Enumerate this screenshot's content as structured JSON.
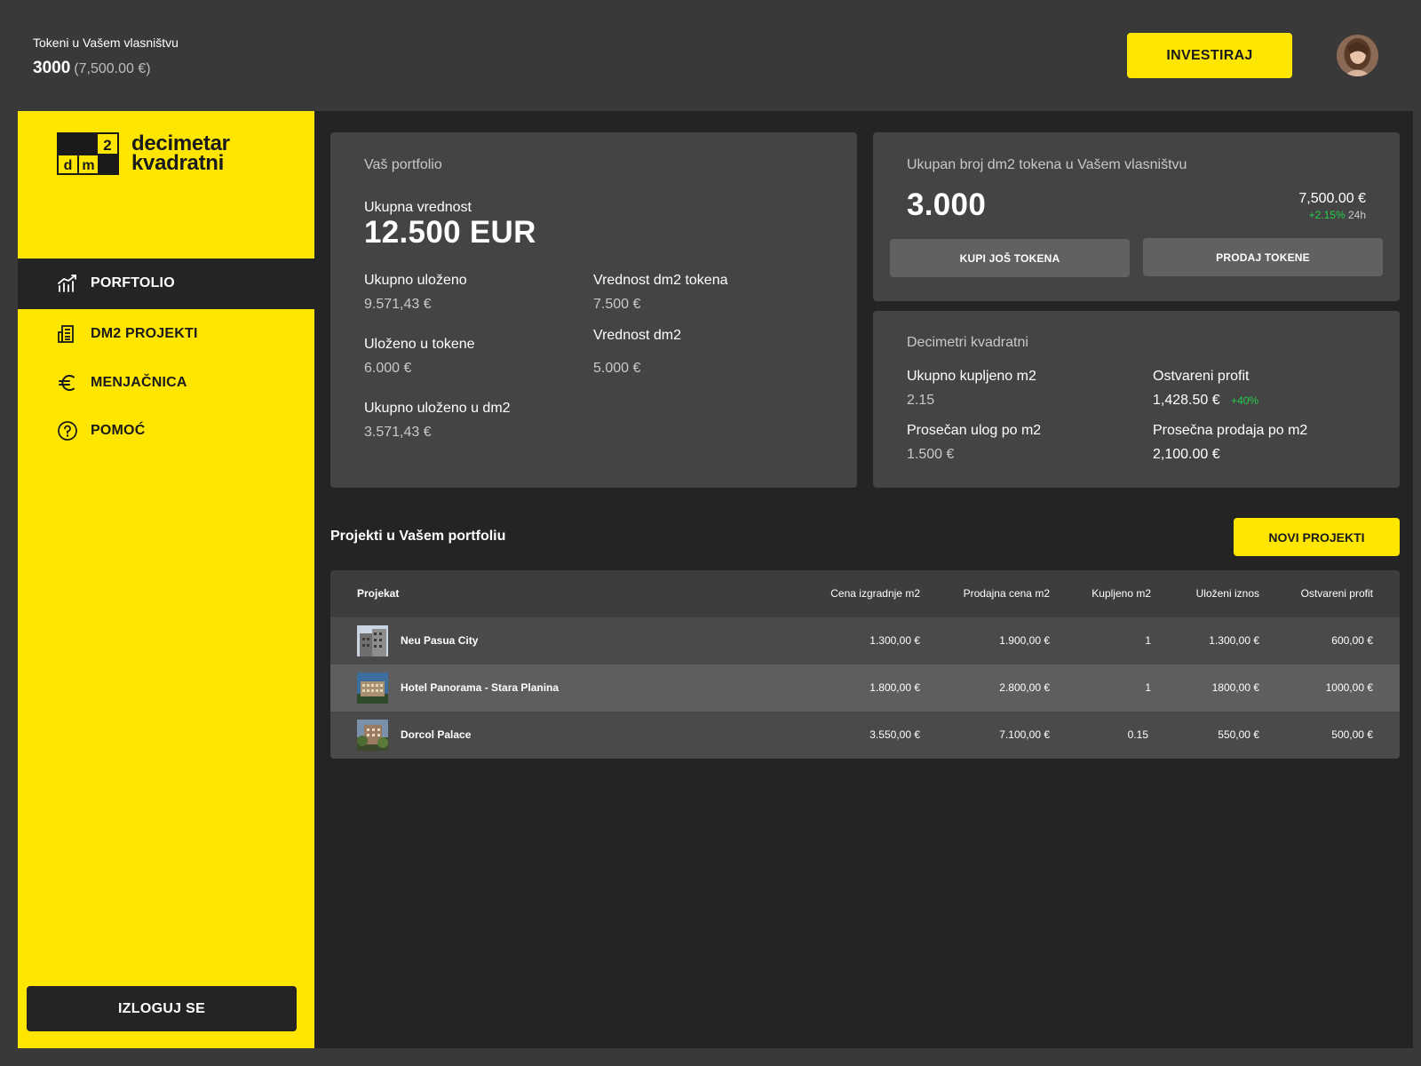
{
  "header": {
    "tokens_label": "Tokeni u Vašem vlasništvu",
    "tokens_count": "3000",
    "tokens_eur": "(7,500.00 €)",
    "invest_label": "INVESTIRAJ"
  },
  "sidebar": {
    "logo_text_line1": "decimetar",
    "logo_text_line2": "kvadratni",
    "logo_mark": {
      "d": "d",
      "m": "m",
      "two": "2"
    },
    "items": [
      {
        "label": "PORFTOLIO",
        "icon": "chart-icon",
        "active": true
      },
      {
        "label": "DM2 PROJEKTI",
        "icon": "building-icon",
        "active": false
      },
      {
        "label": "MENJAČNICA",
        "icon": "euro-icon",
        "active": false
      },
      {
        "label": "POMOĆ",
        "icon": "help-icon",
        "active": false
      }
    ],
    "logout_label": "IZLOGUJ SE"
  },
  "portfolio": {
    "title": "Vaš portfolio",
    "total_label": "Ukupna vrednost",
    "total_value": "12.500 EUR",
    "invested_label": "Ukupno uloženo",
    "invested_value": "9.571,43 €",
    "token_value_label": "Vrednost dm2 tokena",
    "token_value": "7.500 €",
    "in_tokens_label": "Uloženo u tokene",
    "in_tokens_value": "6.000 €",
    "dm2_value_label": "Vrednost dm2",
    "dm2_value": "5.000 €",
    "in_dm2_label": "Ukupno uloženo u dm2",
    "in_dm2_value": "3.571,43 €"
  },
  "tokens_card": {
    "title": "Ukupan broj dm2 tokena u Vašem vlasništvu",
    "count": "3.000",
    "eur_value": "7,500.00 €",
    "change": "+2.15%",
    "period": "24h",
    "buy_label": "KUPI JOŠ TOKENA",
    "sell_label": "PRODAJ TOKENE"
  },
  "dm2_card": {
    "title": "Decimetri kvadratni",
    "bought_label": "Ukupno kupljeno m2",
    "bought_value": "2.15",
    "profit_label": "Ostvareni profit",
    "profit_value": "1,428.50 €",
    "profit_change": "+40%",
    "avg_invest_label": "Prosečan ulog po m2",
    "avg_invest_value": "1.500 €",
    "avg_sale_label": "Prosečna prodaja po m2",
    "avg_sale_value": "2,100.00 €"
  },
  "projects": {
    "title": "Projekti u Vašem portfoliu",
    "new_button": "NOVI PROJEKTI",
    "columns": [
      "Projekat",
      "Cena izgradnje m2",
      "Prodajna cena m2",
      "Kupljeno m2",
      "Uloženi iznos",
      "Ostvareni profit"
    ],
    "rows": [
      {
        "name": "Neu Pasua City",
        "build": "1.300,00 €",
        "sale": "1.900,00 €",
        "bought": "1",
        "invested": "1.300,00 €",
        "profit": "600,00 €"
      },
      {
        "name": "Hotel Panorama - Stara Planina",
        "build": "1.800,00 €",
        "sale": "2.800,00 €",
        "bought": "1",
        "invested": "1800,00 €",
        "profit": "1000,00 €"
      },
      {
        "name": "Dorcol Palace",
        "build": "3.550,00 €",
        "sale": "7.100,00 €",
        "bought": "0.15",
        "invested": "550,00 €",
        "profit": "500,00 €"
      }
    ]
  },
  "colors": {
    "accent": "#ffe600",
    "background": "#393939",
    "panel": "#242424",
    "card": "#444444",
    "positive": "#22d14c"
  }
}
